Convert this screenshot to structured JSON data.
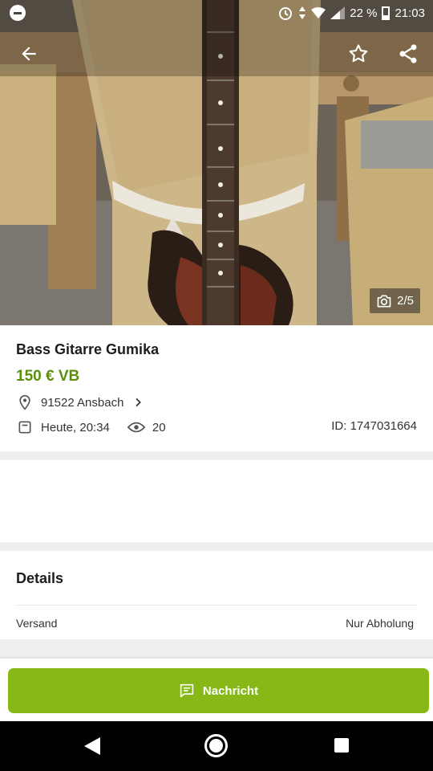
{
  "status_bar": {
    "battery": "22 %",
    "time": "21:03"
  },
  "gallery": {
    "counter": "2/5"
  },
  "listing": {
    "title": "Bass Gitarre Gumika",
    "price": "150 € VB",
    "location": "91522 Ansbach",
    "date": "Heute, 20:34",
    "views": "20",
    "id": "ID: 1747031664"
  },
  "details": {
    "heading": "Details",
    "rows": [
      {
        "label": "Versand",
        "value": "Nur Abholung"
      }
    ]
  },
  "actions": {
    "message_label": "Nachricht"
  },
  "colors": {
    "price_green": "#5b8f0c",
    "button_green": "#86b817"
  },
  "icons": {
    "toolbar": [
      "back-arrow-icon",
      "star-icon",
      "share-icon"
    ],
    "info": [
      "location-pin-icon",
      "chevron-right-icon",
      "calendar-icon",
      "eye-icon",
      "camera-icon"
    ],
    "button": "message-icon"
  }
}
